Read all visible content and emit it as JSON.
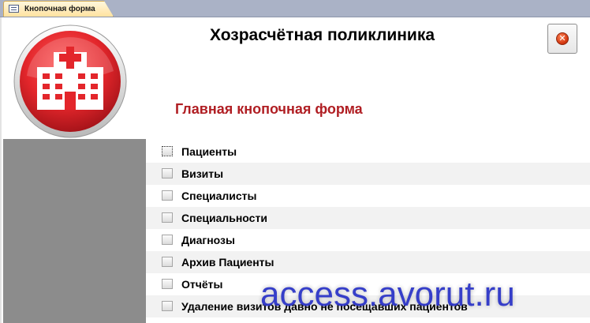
{
  "tab": {
    "label": "Кнопочная форма",
    "icon": "form-icon"
  },
  "header": {
    "title": "Хозрасчётная поликлиника",
    "subtitle": "Главная кнопочная форма",
    "logo_icon": "hospital-icon",
    "close_icon": "close-icon"
  },
  "menu": {
    "items": [
      {
        "label": "Пациенты"
      },
      {
        "label": "Визиты"
      },
      {
        "label": "Специалисты"
      },
      {
        "label": "Специальности"
      },
      {
        "label": "Диагнозы"
      },
      {
        "label": "Архив Пациенты"
      },
      {
        "label": "Отчёты"
      },
      {
        "label": "Удаление визитов давно не посещавших пациентов"
      }
    ]
  },
  "watermark": "access.avorut.ru",
  "colors": {
    "subtitle": "#b01e23",
    "logo_red": "#e3262b",
    "panel_gray": "#8c8c8c",
    "tab_bar": "#aab2c6",
    "watermark": "#2c35c7"
  }
}
